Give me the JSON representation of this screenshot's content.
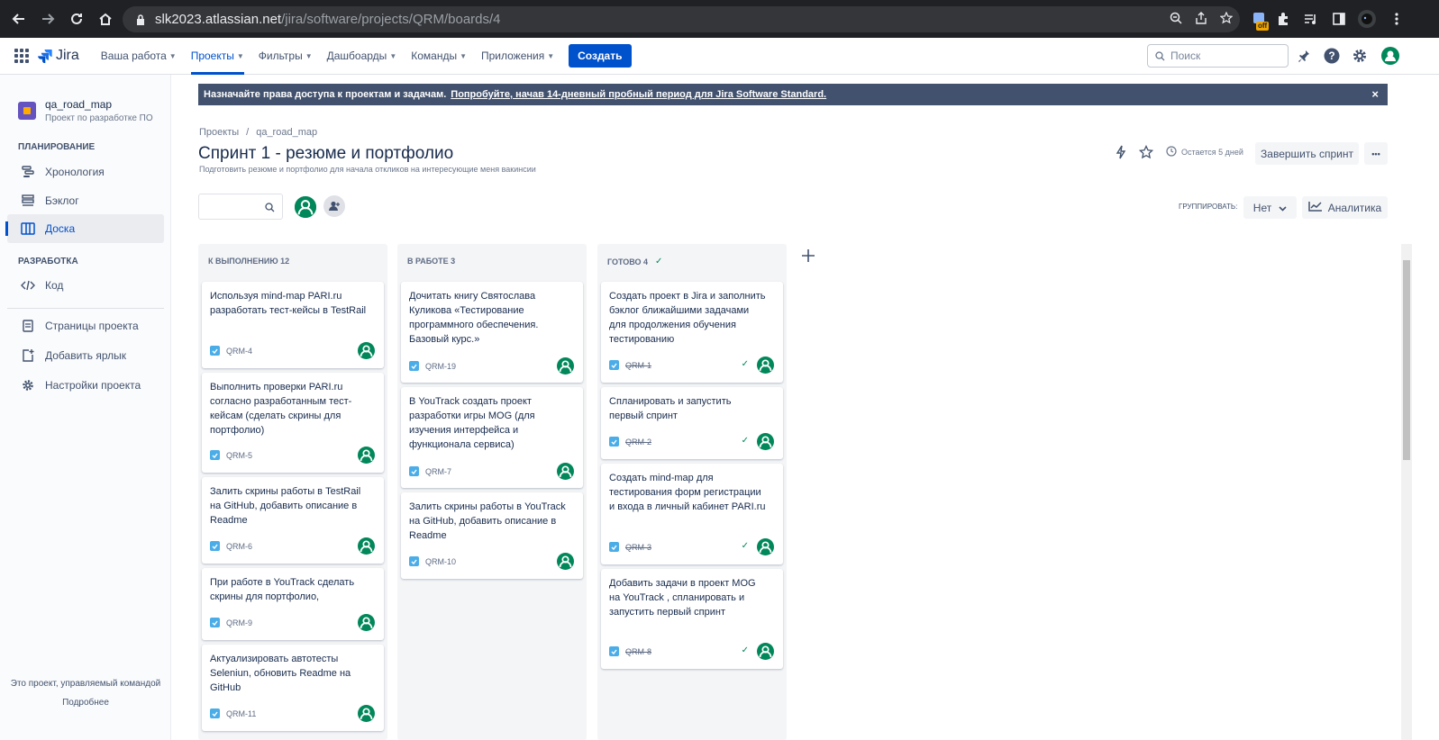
{
  "browser": {
    "url_host": "slk2023.atlassian.net",
    "url_path": "/jira/software/projects/QRM/boards/4",
    "ext_badge": "off"
  },
  "topnav": {
    "logo": "Jira",
    "items": [
      {
        "label": "Ваша работа"
      },
      {
        "label": "Проекты"
      },
      {
        "label": "Фильтры"
      },
      {
        "label": "Дашбоарды"
      },
      {
        "label": "Команды"
      },
      {
        "label": "Приложения"
      }
    ],
    "create": "Создать",
    "search_placeholder": "Поиск"
  },
  "sidebar": {
    "project_name": "qa_road_map",
    "project_sub": "Проект по разработке ПО",
    "section_planning": "ПЛАНИРОВАНИЕ",
    "timeline": "Хронология",
    "backlog": "Бэклог",
    "board": "Доска",
    "section_dev": "РАЗРАБОТКА",
    "code": "Код",
    "pages": "Страницы проекта",
    "add_shortcut": "Добавить ярлык",
    "settings": "Настройки проекта",
    "footer": "Это проект, управляемый командой",
    "more": "Подробнее"
  },
  "banner": {
    "text": "Назначайте права доступа к проектам и задачам.",
    "link": "Попробуйте, начав 14-дневный пробный период для Jira Software Standard.",
    "close": "×"
  },
  "header": {
    "breadcrumb_1": "Проекты",
    "breadcrumb_sep": "/",
    "breadcrumb_2": "qa_road_map",
    "title": "Спринт 1 - резюме и портфолио",
    "description": "Подготовить резюме и портфолио для начала откликов на интересующие меня вакинсии",
    "remaining": "Остается 5 дней",
    "complete_sprint": "Завершить спринт",
    "more": "•••"
  },
  "toolbar": {
    "group_label": "ГРУППИРОВАТЬ:",
    "group_value": "Нет",
    "analytics": "Аналитика"
  },
  "columns": [
    {
      "title": "К ВЫПОЛНЕНИЮ 12",
      "cards": [
        {
          "summary": "Используя mind-map PARI.ru разработать тест-кейсы в TestRail",
          "key": "QRM-4"
        },
        {
          "summary": "Выполнить проверки PARI.ru согласно разработанным тест-кейсам (сделать скрины для портфолио)",
          "key": "QRM-5"
        },
        {
          "summary": "Залить скрины работы в TestRail на GitHub, добавить описание в Readme",
          "key": "QRM-6"
        },
        {
          "summary": "При работе в YouTrack сделать скрины для портфолио,",
          "key": "QRM-9"
        },
        {
          "summary": "Актуализировать автотесты Seleniun, обновить Readme на GitHub",
          "key": "QRM-11"
        }
      ]
    },
    {
      "title": "В РАБОТЕ 3",
      "cards": [
        {
          "summary": "Дочитать книгу Святослава Куликова «Тестирование программного обеспечения. Базовый курс.»",
          "key": "QRM-19"
        },
        {
          "summary": "В YouTrack создать проект разработки игры MOG (для изучения интерфейса и функционала сервиса)",
          "key": "QRM-7"
        },
        {
          "summary": "Залить скрины работы в YouTrack на GitHub, добавить описание в Readme",
          "key": "QRM-10"
        }
      ]
    },
    {
      "title": "ГОТОВО 4",
      "cards": [
        {
          "summary": "Создать проект в Jira и заполнить бэклог ближайшими задачами для продолжения обучения тестированию",
          "key": "QRM-1"
        },
        {
          "summary": "Спланировать и запустить первый спринт",
          "key": "QRM-2"
        },
        {
          "summary": "Создать mind-map для тестирования форм регистрации и входа в личный кабинет PARI.ru",
          "key": "QRM-3"
        },
        {
          "summary": "Добавить задачи в проект MOG на YouTrack , спланировать и запустить первый спринт",
          "key": "QRM-8"
        }
      ]
    }
  ]
}
